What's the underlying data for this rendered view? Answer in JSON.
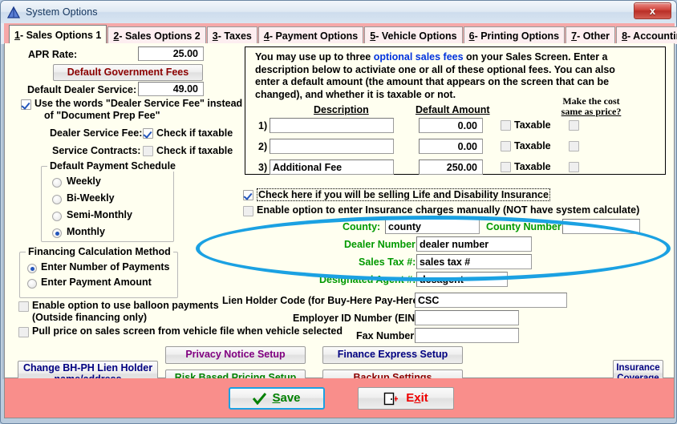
{
  "window": {
    "title": "System Options",
    "icon": "triangle-icon",
    "close_label": "x",
    "close_color": "#c6372e"
  },
  "tabs": [
    {
      "num": "1",
      "label": " - Sales Options 1",
      "active": true
    },
    {
      "num": "2",
      "label": " - Sales Options 2",
      "active": false
    },
    {
      "num": "3",
      "label": " - Taxes",
      "active": false
    },
    {
      "num": "4",
      "label": " - Payment Options",
      "active": false
    },
    {
      "num": "5",
      "label": " - Vehicle Options",
      "active": false
    },
    {
      "num": "6",
      "label": " - Printing Options",
      "active": false
    },
    {
      "num": "7",
      "label": " - Other",
      "active": false
    },
    {
      "num": "8",
      "label": " - Accounting",
      "active": false
    }
  ],
  "left": {
    "apr_label": "APR Rate:",
    "apr_value": "25.00",
    "default_gov_fees_button": "Default Government Fees",
    "default_gov_fees_color": "#8b0000",
    "dealer_service_label": "Default Dealer Service:",
    "dealer_service_value": "49.00",
    "use_words_line1": "Use the words \"Dealer Service Fee\" instead",
    "use_words_line2": "of \"Document Prep Fee\"",
    "dealer_service_fee_label": "Dealer Service Fee:",
    "dealer_service_fee_check": "Check if taxable",
    "service_contracts_label": "Service Contracts:",
    "service_contracts_check": "Check if taxable",
    "payment_schedule_title": "Default Payment Schedule",
    "payment_schedule_options": [
      "Weekly",
      "Bi-Weekly",
      "Semi-Monthly",
      "Monthly"
    ],
    "payment_schedule_selected": "Monthly",
    "financing_title": "Financing Calculation Method",
    "financing_options": [
      "Enter Number of Payments",
      "Enter Payment Amount"
    ],
    "financing_selected": "Enter Number of Payments",
    "balloon_line1": "Enable option to use balloon payments",
    "balloon_line2": "(Outside financing only)",
    "pull_price_label": "Pull price on sales screen from vehicle file when vehicle selected"
  },
  "fees_panel": {
    "intro_part1": "You may use up to three ",
    "intro_link": "optional sales fees",
    "intro_part2": " on your Sales Screen.  Enter a",
    "intro_line2": "description below to activiate one or all of these optional fees.  You can also",
    "intro_line3": "enter a default amount (the amount that appears on the screen that can be",
    "intro_line4": "changed), and whether it is taxable or not.",
    "col_description": "Description",
    "col_default_amount": "Default Amount",
    "col_same_as_price_line1": "Make the cost",
    "col_same_as_price_line2": "same as price?",
    "rows": [
      {
        "num": "1)",
        "description": "",
        "amount": "0.00",
        "taxable_label": "Taxable",
        "taxable": false,
        "same_as_price": false
      },
      {
        "num": "2)",
        "description": "",
        "amount": "0.00",
        "taxable_label": "Taxable",
        "taxable": false,
        "same_as_price": false
      },
      {
        "num": "3)",
        "description": "Additional Fee",
        "amount": "250.00",
        "taxable_label": "Taxable",
        "taxable": false,
        "same_as_price": false
      }
    ]
  },
  "insurance": {
    "sell_life_disability": "Check here if you will be selling Life and Disability Insurance",
    "sell_life_disability_checked": true,
    "manual_charges": "Enable option to enter Insurance charges manually (NOT have system calculate)",
    "manual_charges_checked": false,
    "highlight_color": "#1ba1e2"
  },
  "dealer_fields": [
    {
      "label": "County:",
      "value": "county"
    },
    {
      "label": "County Number:",
      "value": ""
    },
    {
      "label": "Dealer Number:",
      "value": "dealer number"
    },
    {
      "label": "Sales Tax #:",
      "value": "sales tax #"
    },
    {
      "label": "Designated Agent #:",
      "value": "desagent"
    }
  ],
  "right_fields": [
    {
      "label": "Lien Holder Code (for Buy-Here Pay-Here):",
      "value": "CSC"
    },
    {
      "label": "Employer ID Number (EIN):",
      "value": ""
    },
    {
      "label": "Fax Number:",
      "value": ""
    }
  ],
  "action_buttons": {
    "privacy_notice": "Privacy Notice Setup",
    "privacy_notice_color": "#800080",
    "finance_express": "Finance Express Setup",
    "finance_express_color": "#000080",
    "risk_based": "Risk Based Pricing Setup",
    "risk_based_color": "#008000",
    "backup_settings": "Backup Settings",
    "backup_settings_color": "#8b0000",
    "change_lien_line1": "Change BH-PH Lien Holder",
    "change_lien_line2": "name/address",
    "change_lien_color": "#000080",
    "insurance_coverage_line1": "Insurance",
    "insurance_coverage_line2": "Coverage",
    "insurance_coverage_color": "#000080"
  },
  "footer": {
    "save_label": "Save",
    "save_accel": "S",
    "save_color": "#008000",
    "exit_label": "Exit",
    "exit_accel": "x",
    "exit_color": "#ee0000",
    "bar_color": "#f98e8b"
  }
}
